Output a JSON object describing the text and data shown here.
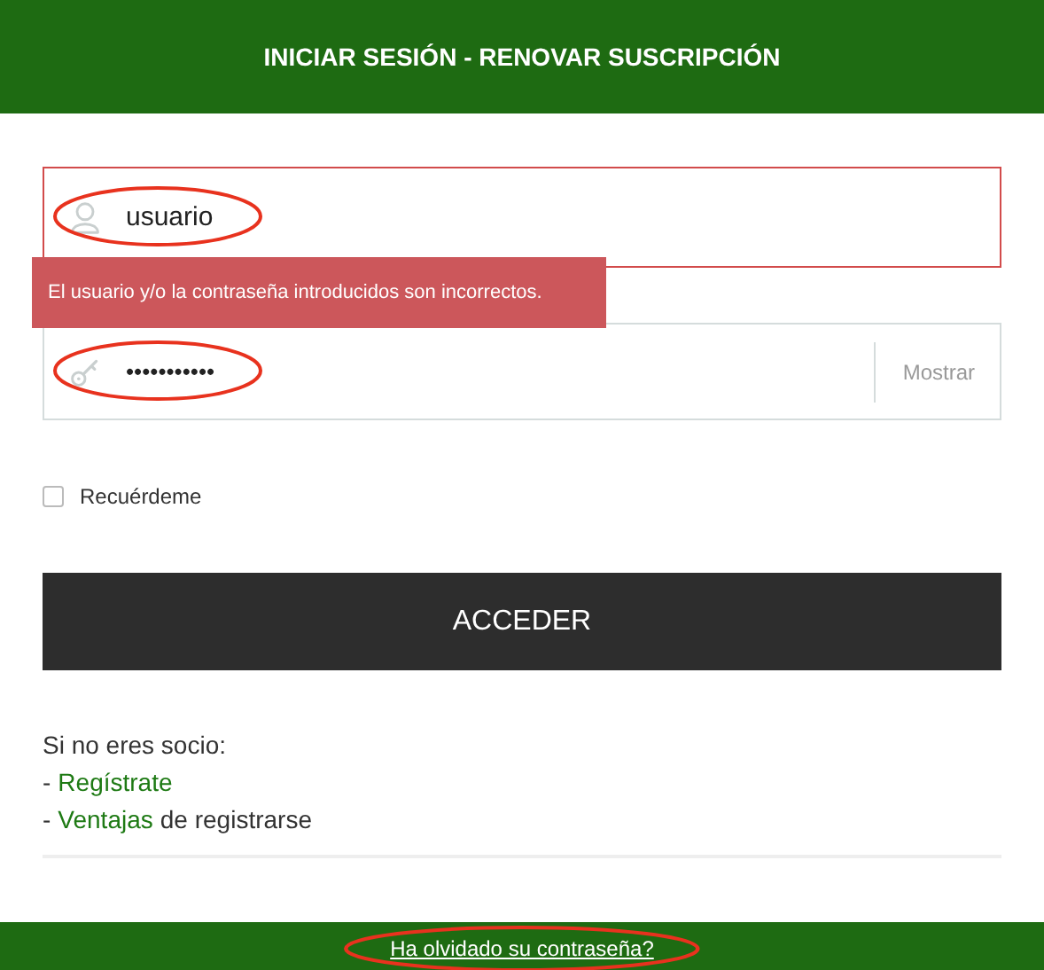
{
  "header": {
    "title": "INICIAR SESIÓN - RENOVAR SUSCRIPCIÓN"
  },
  "username_field": {
    "value": "usuario",
    "error": true,
    "highlighted": true
  },
  "error_tooltip": {
    "text": "El usuario y/o la contraseña introducidos son incorrectos."
  },
  "password_field": {
    "value": "•••••••••••",
    "error": false,
    "highlighted": true,
    "show_button": "Mostrar"
  },
  "remember_me": {
    "label": "Recuérdeme",
    "checked": false
  },
  "submit_button": "ACCEDER",
  "register": {
    "intro": "Si no eres socio:",
    "lines": [
      {
        "prefix": "-",
        "link": "Regístrate"
      },
      {
        "prefix": "-",
        "link": "Ventajas",
        "suffix": "de registrarse"
      }
    ]
  },
  "footer": {
    "link": "Ha olvidado su contraseña?",
    "highlighted": true
  }
}
